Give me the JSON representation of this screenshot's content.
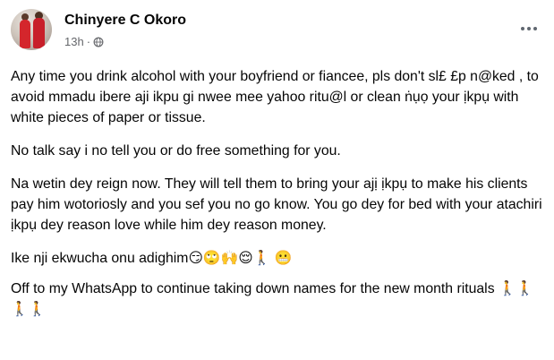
{
  "post": {
    "author": "Chinyere C Okoro",
    "time": "13h",
    "separator": "·",
    "audience_icon": "globe-icon",
    "more_icon": "more-options-icon",
    "paragraphs": [
      "Any time you drink alcohol with your boyfriend or fiancee, pls don't sl£ £p n@ked , to avoid mmadu ibere aji ikpu gi nwee mee yahoo ritu@l or clean ṅụọ your ịkpụ with white pieces of paper or tissue.",
      "No talk say i no tell you or do free something for you.",
      "Na wetin dey reign now. They will tell them to bring your ajị ịkpụ to make his clients pay him wotoriosly and you sef you no go know. You go dey for bed with your atachiri ịkpụ dey reason love while him dey reason money.",
      "Ike nji ekwucha onu adighim😏🙄🙌😌🚶 😬",
      "Off to my WhatsApp to continue taking down names for the new month rituals 🚶🚶🚶🚶"
    ]
  },
  "colors": {
    "text": "#050505",
    "secondary": "#65676b",
    "background": "#ffffff"
  }
}
